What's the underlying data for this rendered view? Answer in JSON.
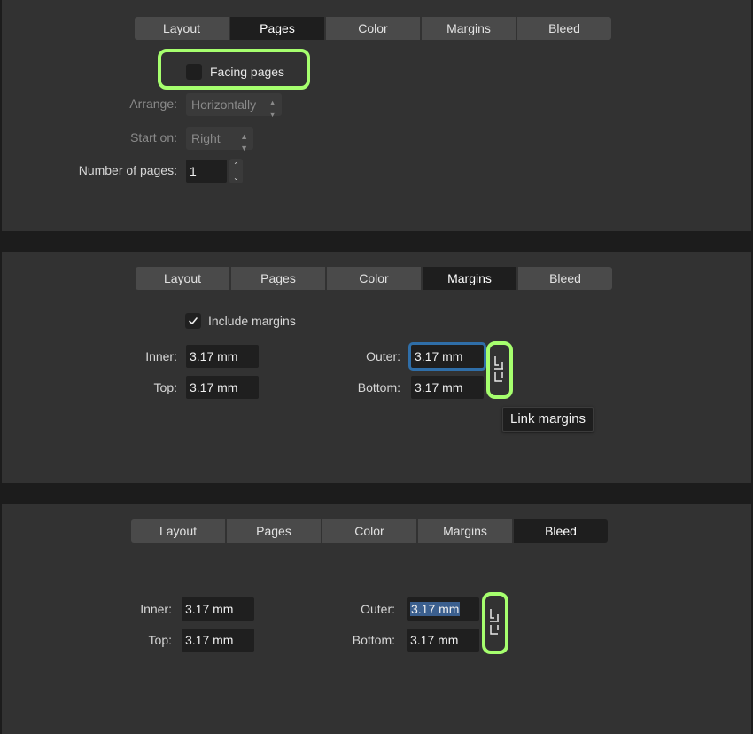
{
  "tabs": [
    "Layout",
    "Pages",
    "Color",
    "Margins",
    "Bleed"
  ],
  "pages_panel": {
    "active_tab": "Pages",
    "facing_pages_label": "Facing pages",
    "facing_pages_checked": false,
    "arrange_label": "Arrange:",
    "arrange_value": "Horizontally",
    "start_on_label": "Start on:",
    "start_on_value": "Right",
    "num_pages_label": "Number of pages:",
    "num_pages_value": "1"
  },
  "margins_panel": {
    "active_tab": "Margins",
    "include_margins_label": "Include margins",
    "include_margins_checked": true,
    "inner_label": "Inner:",
    "inner_value": "3.17 mm",
    "top_label": "Top:",
    "top_value": "3.17 mm",
    "outer_label": "Outer:",
    "outer_value": "3.17 mm",
    "bottom_label": "Bottom:",
    "bottom_value": "3.17 mm",
    "link_tooltip": "Link margins"
  },
  "bleed_panel": {
    "active_tab": "Bleed",
    "inner_label": "Inner:",
    "inner_value": "3.17 mm",
    "top_label": "Top:",
    "top_value": "3.17 mm",
    "outer_label": "Outer:",
    "outer_value": "3.17 mm",
    "bottom_label": "Bottom:",
    "bottom_value": "3.17 mm"
  },
  "colors": {
    "highlight": "#a6ff6e",
    "focus_ring": "#2f6ea8",
    "active_tab_bg": "#1e1e1e",
    "panel_bg": "#323232"
  },
  "icons": {
    "link": "chain-link-icon",
    "check": "checkmark-icon",
    "stepper": "chevron-up-down-icon"
  }
}
